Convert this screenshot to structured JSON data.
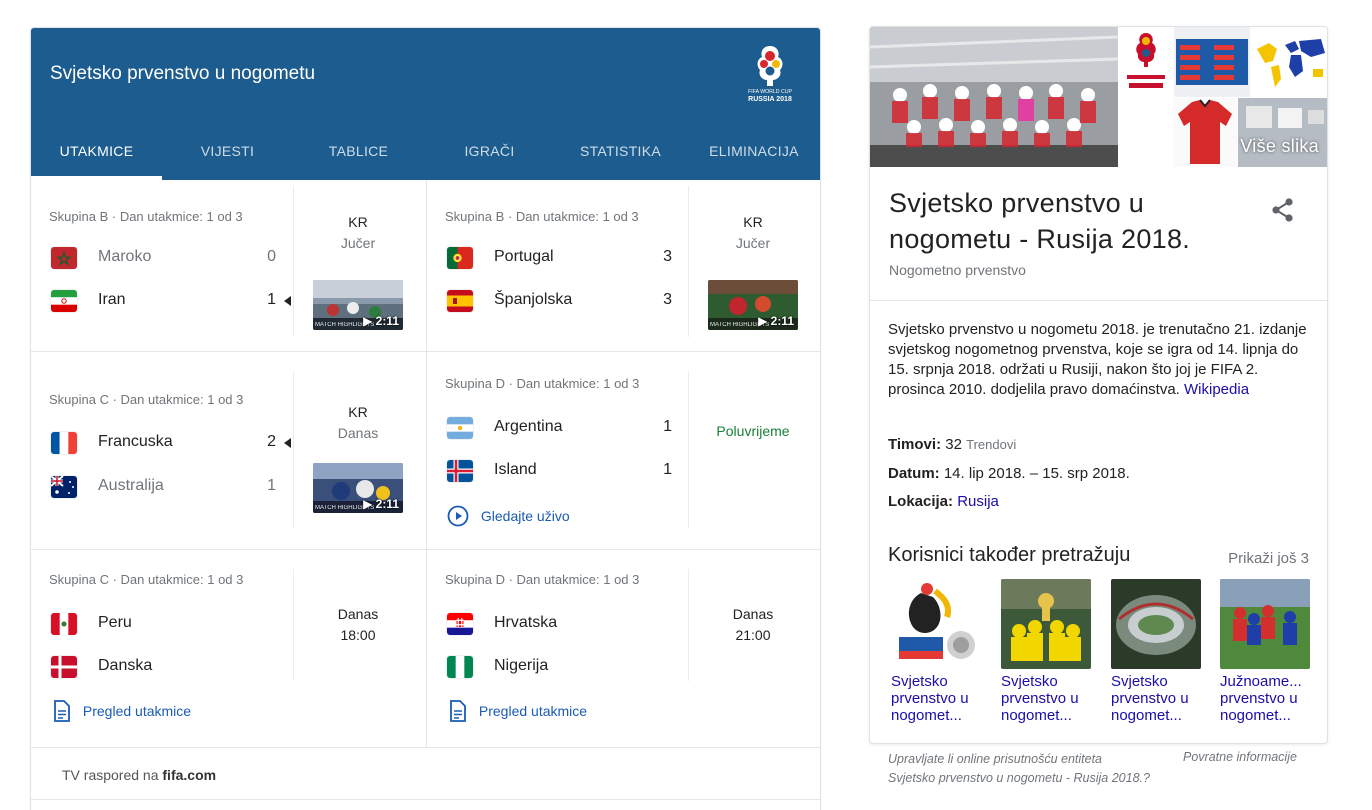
{
  "card": {
    "title": "Svjetsko prvenstvo u nogometu",
    "logo_text": [
      "FIFA WORLD CUP",
      "RUSSIA 2018"
    ],
    "tabs": [
      "UTAKMICE",
      "VIJESTI",
      "TABLICE",
      "IGRAČI",
      "STATISTIKA",
      "ELIMINACIJA"
    ],
    "active_tab": "UTAKMICE"
  },
  "matches": [
    {
      "group": "Skupina B · Dan utakmice: 1 od 3",
      "home": {
        "name": "Maroko",
        "score": "0",
        "flag": "morocco",
        "loser": true
      },
      "away": {
        "name": "Iran",
        "score": "1",
        "flag": "iran",
        "winner": true
      },
      "status_line1": "KR",
      "status_line2": "Jučer",
      "video": {
        "label": "MATCH HIGHLIGHTS",
        "duration": "▶ 2:11"
      }
    },
    {
      "group": "Skupina B · Dan utakmice: 1 od 3",
      "home": {
        "name": "Portugal",
        "score": "3",
        "flag": "portugal"
      },
      "away": {
        "name": "Španjolska",
        "score": "3",
        "flag": "spain"
      },
      "status_line1": "KR",
      "status_line2": "Jučer",
      "video": {
        "label": "MATCH HIGHLIGHTS",
        "duration": "▶ 2:11"
      }
    },
    {
      "group": "Skupina C · Dan utakmice: 1 od 3",
      "home": {
        "name": "Francuska",
        "score": "2",
        "flag": "france",
        "winner": true
      },
      "away": {
        "name": "Australija",
        "score": "1",
        "flag": "australia",
        "loser": true
      },
      "status_line1": "KR",
      "status_line2": "Danas",
      "video": {
        "label": "MATCH HIGHLIGHTS",
        "duration": "▶ 2:11"
      }
    },
    {
      "group": "Skupina D · Dan utakmice: 1 od 3",
      "home": {
        "name": "Argentina",
        "score": "1",
        "flag": "argentina"
      },
      "away": {
        "name": "Island",
        "score": "1",
        "flag": "iceland"
      },
      "status_live": "Poluvrijeme",
      "link": "Gledajte uživo"
    },
    {
      "group": "Skupina C · Dan utakmice: 1 od 3",
      "home": {
        "name": "Peru",
        "flag": "peru"
      },
      "away": {
        "name": "Danska",
        "flag": "denmark"
      },
      "status_line1": "Danas",
      "status_line2": "18:00",
      "link": "Pregled utakmice"
    },
    {
      "group": "Skupina D · Dan utakmice: 1 od 3",
      "home": {
        "name": "Hrvatska",
        "flag": "croatia"
      },
      "away": {
        "name": "Nigerija",
        "flag": "nigeria"
      },
      "status_line1": "Danas",
      "status_line2": "21:00",
      "link": "Pregled utakmice"
    }
  ],
  "tv": {
    "prefix": "TV raspored na ",
    "site": "fifa.com"
  },
  "panel": {
    "more_images": "Više slika",
    "title": "Svjetsko prvenstvo u nogometu - Rusija 2018.",
    "subtitle": "Nogometno prvenstvo",
    "description": "Svjetsko prvenstvo u nogometu 2018. je trenutačno 21. izdanje svjetskog nogometnog prvenstva, koje se igra od 14. lipnja do 15. srpnja 2018. održati u Rusiji, nakon što joj je FIFA 2. prosinca 2010. dodjelila pravo domaćinstva.",
    "description_source": "Wikipedia",
    "facts": {
      "teams_label": "Timovi:",
      "teams_value": "32",
      "teams_extra": "Trendovi",
      "date_label": "Datum:",
      "date_value": "14. lip 2018. – 15. srp 2018.",
      "location_label": "Lokacija:",
      "location_value": "Rusija"
    },
    "also_search_title": "Korisnici također pretražuju",
    "also_search_more": "Prikaži još 3",
    "also_search": [
      {
        "line1": "Svjetsko",
        "line2": "prvenstvo u",
        "line3": "nogomet..."
      },
      {
        "line1": "Svjetsko",
        "line2": "prvenstvo u",
        "line3": "nogomet..."
      },
      {
        "line1": "Svjetsko",
        "line2": "prvenstvo u",
        "line3": "nogomet..."
      },
      {
        "line1": "Južnoame...",
        "line2": "prvenstvo u",
        "line3": "nogomet..."
      }
    ]
  },
  "footer": {
    "claim_line1": "Upravljate li online prisutnošću entiteta",
    "claim_line2": "Svjetsko prvenstvo u nogometu - Rusija 2018.?",
    "feedback": "Povratne informacije"
  },
  "colors": {
    "header_blue": "#1c5c8e",
    "link_blue": "#1a5bb5",
    "live_green": "#188038"
  }
}
